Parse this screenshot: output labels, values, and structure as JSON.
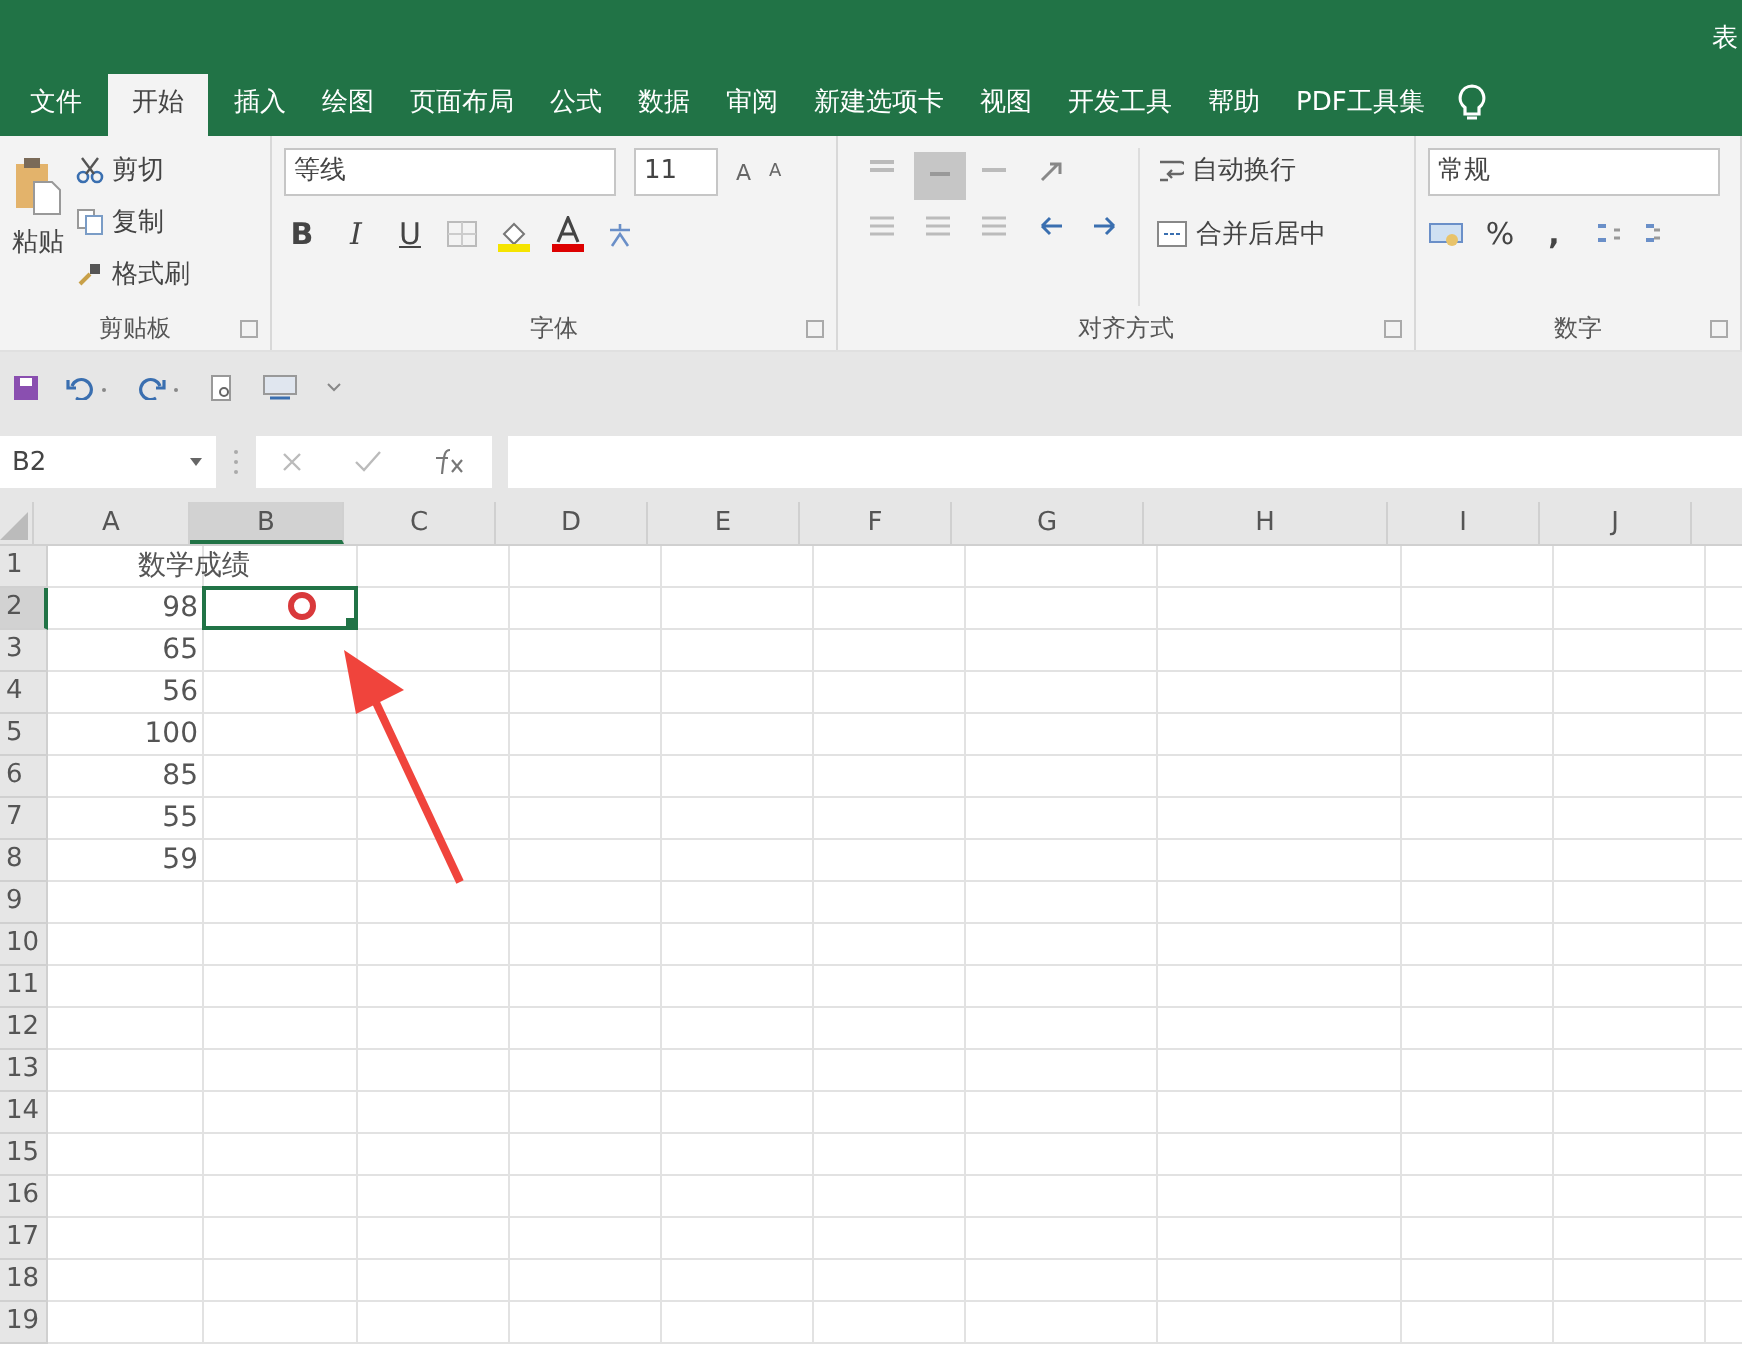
{
  "window": {
    "title": "表"
  },
  "tabs": [
    {
      "label": "文件",
      "selected": false
    },
    {
      "label": "开始",
      "selected": true
    },
    {
      "label": "插入",
      "selected": false
    },
    {
      "label": "绘图",
      "selected": false
    },
    {
      "label": "页面布局",
      "selected": false
    },
    {
      "label": "公式",
      "selected": false
    },
    {
      "label": "数据",
      "selected": false
    },
    {
      "label": "审阅",
      "selected": false
    },
    {
      "label": "新建选项卡",
      "selected": false
    },
    {
      "label": "视图",
      "selected": false
    },
    {
      "label": "开发工具",
      "selected": false
    },
    {
      "label": "帮助",
      "selected": false
    },
    {
      "label": "PDF工具集",
      "selected": false
    }
  ],
  "ribbon": {
    "clipboard": {
      "paste": "粘贴",
      "cut": "剪切",
      "copy": "复制",
      "format_painter": "格式刷",
      "label": "剪贴板"
    },
    "font": {
      "name": "等线",
      "size": "11",
      "grow": "A",
      "shrink": "A",
      "bold": "B",
      "italic": "I",
      "underline": "U",
      "label": "字体"
    },
    "alignment": {
      "wrap": "自动换行",
      "merge": "合并后居中",
      "label": "对齐方式"
    },
    "number": {
      "format": "常规",
      "percent": "%",
      "comma": ",",
      "label": "数字"
    }
  },
  "name_box": "B2",
  "columns": [
    {
      "label": "A",
      "selected": false
    },
    {
      "label": "B",
      "selected": true
    },
    {
      "label": "C",
      "selected": false
    },
    {
      "label": "D",
      "selected": false
    },
    {
      "label": "E",
      "selected": false
    },
    {
      "label": "F",
      "selected": false
    },
    {
      "label": "G",
      "selected": false
    },
    {
      "label": "H",
      "selected": false
    },
    {
      "label": "I",
      "selected": false
    },
    {
      "label": "J",
      "selected": false
    }
  ],
  "rows": [
    {
      "label": "1",
      "selected": false,
      "value": "数学成绩",
      "kind": "text"
    },
    {
      "label": "2",
      "selected": true,
      "value": "98",
      "kind": "number"
    },
    {
      "label": "3",
      "selected": false,
      "value": "65",
      "kind": "number"
    },
    {
      "label": "4",
      "selected": false,
      "value": "56",
      "kind": "number"
    },
    {
      "label": "5",
      "selected": false,
      "value": "100",
      "kind": "number"
    },
    {
      "label": "6",
      "selected": false,
      "value": "85",
      "kind": "number"
    },
    {
      "label": "7",
      "selected": false,
      "value": "55",
      "kind": "number"
    },
    {
      "label": "8",
      "selected": false,
      "value": "59",
      "kind": "number"
    },
    {
      "label": "9",
      "selected": false
    },
    {
      "label": "10",
      "selected": false
    },
    {
      "label": "11",
      "selected": false
    },
    {
      "label": "12",
      "selected": false
    },
    {
      "label": "13",
      "selected": false
    },
    {
      "label": "14",
      "selected": false
    },
    {
      "label": "15",
      "selected": false
    },
    {
      "label": "16",
      "selected": false
    },
    {
      "label": "17",
      "selected": false
    },
    {
      "label": "18",
      "selected": false
    },
    {
      "label": "19",
      "selected": false
    }
  ]
}
